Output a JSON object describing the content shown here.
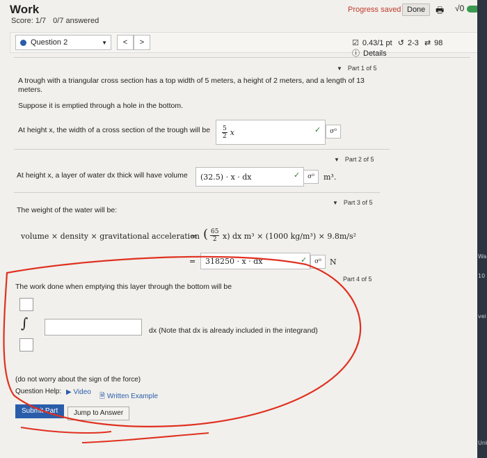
{
  "header": {
    "title": "Work",
    "score": "Score: 1/7",
    "answered": "0/7 answered",
    "progress_saved": "Progress saved",
    "done": "Done",
    "sqrt_symbol": "√0"
  },
  "question_bar": {
    "question_label": "Question 2",
    "prev": "<",
    "next": ">",
    "points": "0.43/1 pt",
    "attempts": "2-3",
    "retries": "98",
    "details": "Details"
  },
  "problem": {
    "part1_label": "Part 1 of 5",
    "intro": "A trough with a triangular cross section has a top width of 5 meters, a height of 2 meters, and a length of 13 meters.",
    "suppose": "Suppose it is emptied through a hole in the bottom.",
    "width_prompt": "At height x, the width of a cross section of the trough will be",
    "width_answer_num": "5",
    "width_answer_den": "2",
    "width_answer_var": "x",
    "part2_label": "Part 2 of 5",
    "volume_prompt": "At height x, a layer of water dx thick will have volume",
    "volume_answer": "(32.5) · x · dx",
    "volume_unit": "m³.",
    "part3_label": "Part 3 of 5",
    "weight_prompt": "The weight of the water will be:",
    "weight_formula_left": "volume × density × gravitational acceleration",
    "weight_eq": "=",
    "weight_frac_num": "65",
    "weight_frac_den": "2",
    "weight_formula_right": "x) dx  m³ × (1000  kg/m³) × 9.8m/s²",
    "weight_answer": "318250 · x · dx",
    "weight_unit": "N",
    "part4_label": "Part 4 of 5",
    "work_prompt": "The work done when emptying this layer through the bottom will be",
    "integrand_note": "dx  (Note that dx is already included in the integrand)",
    "force_note": "(do not worry about the sign of the force)",
    "help_label": "Question Help:",
    "video": "Video",
    "written_example": "Written Example",
    "submit": "Submit Part",
    "jump": "Jump to Answer"
  },
  "sidebar_right": [
    "Wa",
    "10",
    "vei",
    "Unk"
  ],
  "colors": {
    "accent": "#2a5caa",
    "annotation": "#e03020",
    "saved": "#c0392b"
  }
}
